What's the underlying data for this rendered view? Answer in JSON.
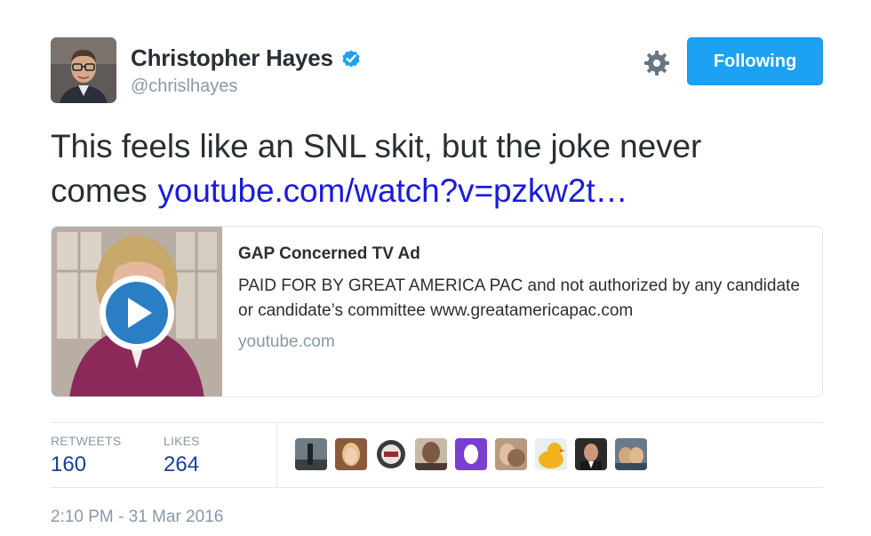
{
  "author": {
    "display_name": "Christopher Hayes",
    "handle": "@chrislhayes",
    "verified": true
  },
  "actions": {
    "follow_label": "Following"
  },
  "tweet": {
    "text": "This feels like an SNL skit, but the joke never comes",
    "link_text": "youtube.com/watch?v=pzkw2t…"
  },
  "card": {
    "title": "GAP Concerned TV Ad",
    "description": "PAID FOR BY GREAT AMERICA PAC and not authorized by any candidate or candidate’s committee www.greatamericapac.com",
    "domain": "youtube.com"
  },
  "stats": {
    "retweets_label": "RETWEETS",
    "retweets_count": "160",
    "likes_label": "LIKES",
    "likes_count": "264"
  },
  "likers": [
    "liker-avatar",
    "liker-avatar",
    "liker-avatar",
    "liker-avatar",
    "liker-avatar",
    "liker-avatar",
    "liker-avatar",
    "liker-avatar",
    "liker-avatar"
  ],
  "timestamp": "2:10 PM - 31 Mar 2016",
  "colors": {
    "accent": "#1da1f2",
    "link": "#1b1bdb",
    "muted": "#8899a6",
    "stat_value": "#1b3f94"
  }
}
